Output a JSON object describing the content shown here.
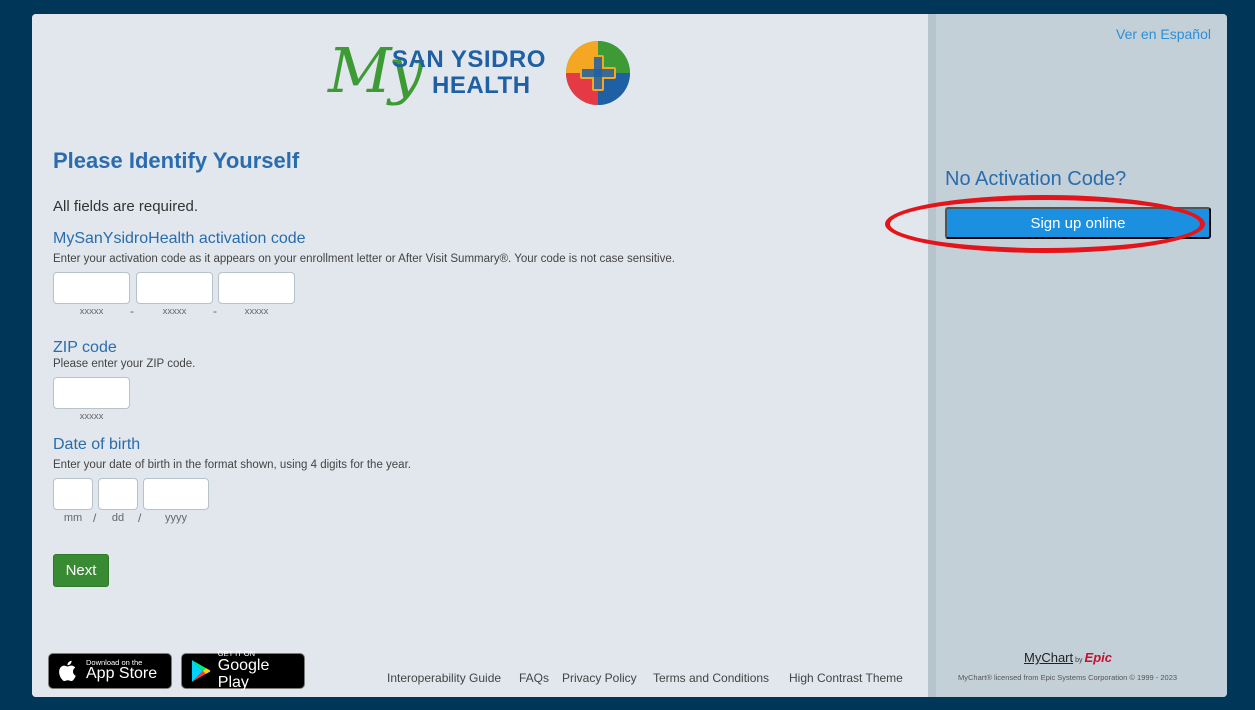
{
  "brand": {
    "logo_my": "My",
    "logo_line1": "SAN YSIDRO",
    "logo_line2": "HEALTH",
    "colors": {
      "green": "#3d9a35",
      "blue": "#1f5fa3",
      "orange": "#f5a623",
      "red": "#e63946",
      "teal": "#2a9d8f"
    }
  },
  "form": {
    "title": "Please Identify Yourself",
    "required_note": "All fields are required.",
    "activation": {
      "label": "MySanYsidroHealth activation code",
      "hint": "Enter your activation code as it appears on your enrollment letter or After Visit Summary®. Your code is not case sensitive.",
      "part_placeholder": "xxxxx",
      "separator": "-"
    },
    "zip": {
      "label": "ZIP code",
      "hint": "Please enter your ZIP code.",
      "placeholder": "xxxxx"
    },
    "dob": {
      "label": "Date of birth",
      "hint": "Enter your date of birth in the format shown, using 4 digits for the year.",
      "mm": "mm",
      "dd": "dd",
      "yyyy": "yyyy",
      "separator": "/"
    },
    "next_label": "Next"
  },
  "badges": {
    "apple_small": "Download on the",
    "apple_big": "App Store",
    "google_small": "GET IT ON",
    "google_big": "Google Play"
  },
  "footer": {
    "links": [
      "Interoperability Guide",
      "FAQs",
      "Privacy Policy",
      "Terms and Conditions",
      "High Contrast Theme"
    ]
  },
  "sidebar": {
    "language_link": "Ver en Español",
    "no_code_heading": "No Activation Code?",
    "signup_label": "Sign up online",
    "mychart": "MyChart",
    "by": "by",
    "epic": "Epic",
    "copyright": "MyChart® licensed from Epic Systems Corporation © 1999 - 2023"
  }
}
